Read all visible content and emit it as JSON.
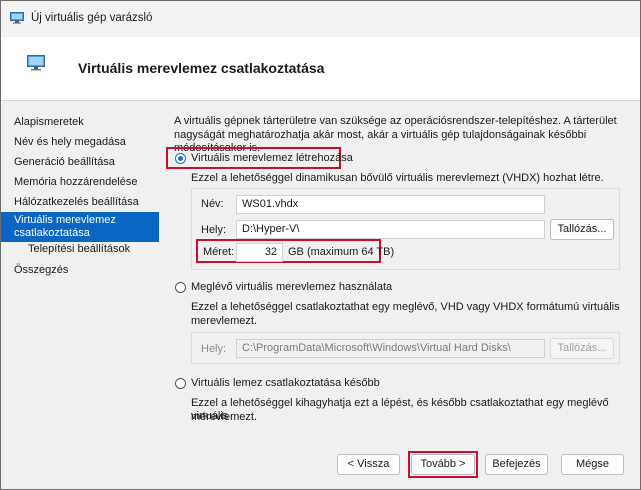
{
  "window": {
    "title": "Új virtuális gép varázsló"
  },
  "header": {
    "title": "Virtuális merevlemez csatlakoztatása"
  },
  "sidebar": {
    "items": [
      {
        "label": "Alapismeretek"
      },
      {
        "label": "Név és hely megadása"
      },
      {
        "label": "Generáció beállítása"
      },
      {
        "label": "Memória hozzárendelése"
      },
      {
        "label": "Hálózatkezelés beállítása"
      },
      {
        "label": "Virtuális merevlemez"
      },
      {
        "label": "csatlakoztatása"
      },
      {
        "label": "Telepítési beállítások"
      },
      {
        "label": "Összegzés"
      }
    ]
  },
  "main": {
    "intro_line1": "A virtuális gépnek tárterületre van szüksége az operációsrendszer-telepítéshez. A tárterület",
    "intro_line2": "nagyságát meghatározhatja akár most, akár a virtuális gép tulajdonságainak későbbi módosításakor is.",
    "option_create": {
      "label": "Virtuális merevlemez létrehozása",
      "selected": true,
      "desc": "Ezzel a lehetőséggel dinamikusan bővülő virtuális merevlemezt (VHDX) hozhat létre.",
      "name_label": "Név:",
      "name_value": "WS01.vhdx",
      "location_label": "Hely:",
      "location_value": "D:\\Hyper-V\\",
      "browse_label": "Tallózás...",
      "size_label": "Méret:",
      "size_value": "32",
      "size_unit": "GB (maximum 64 TB)"
    },
    "option_existing": {
      "label": "Meglévő virtuális merevlemez használata",
      "selected": false,
      "desc_line1": "Ezzel a lehetőséggel csatlakoztathat egy meglévő, VHD vagy VHDX formátumú virtuális",
      "desc_line2": "merevlemezt.",
      "location_label": "Hely:",
      "location_value": "C:\\ProgramData\\Microsoft\\Windows\\Virtual Hard Disks\\",
      "browse_label": "Tallózás..."
    },
    "option_later": {
      "label": "Virtuális lemez csatlakoztatása később",
      "selected": false,
      "desc_line1": "Ezzel a lehetőséggel kihagyhatja ezt a lépést, és később csatlakoztathat egy meglévő virtuális",
      "desc_line2": "merevlemezt."
    }
  },
  "footer": {
    "back_label": "< Vissza",
    "next_label": "Tovább >",
    "finish_label": "Befejezés",
    "cancel_label": "Mégse"
  },
  "colors": {
    "accent": "#0a66c2",
    "highlight": "#c8102e"
  }
}
